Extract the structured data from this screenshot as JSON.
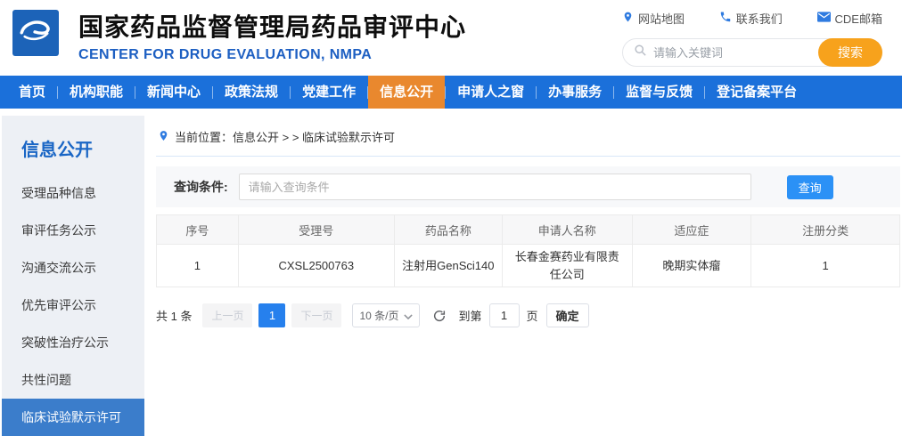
{
  "header": {
    "title": "国家药品监督管理局药品审评中心",
    "subtitle": "CENTER FOR DRUG EVALUATION, NMPA",
    "links": [
      {
        "label": "网站地图",
        "icon": "location-pin-icon"
      },
      {
        "label": "联系我们",
        "icon": "phone-icon"
      },
      {
        "label": "CDE邮箱",
        "icon": "mail-icon"
      }
    ],
    "search": {
      "placeholder": "请输入关键词",
      "button_label": "搜索"
    }
  },
  "nav": {
    "items": [
      {
        "label": "首页",
        "active": false
      },
      {
        "label": "机构职能",
        "active": false
      },
      {
        "label": "新闻中心",
        "active": false
      },
      {
        "label": "政策法规",
        "active": false
      },
      {
        "label": "党建工作",
        "active": false
      },
      {
        "label": "信息公开",
        "active": true
      },
      {
        "label": "申请人之窗",
        "active": false
      },
      {
        "label": "办事服务",
        "active": false
      },
      {
        "label": "监督与反馈",
        "active": false
      },
      {
        "label": "登记备案平台",
        "active": false
      }
    ]
  },
  "sidebar": {
    "title": "信息公开",
    "items": [
      {
        "label": "受理品种信息",
        "selected": false
      },
      {
        "label": "审评任务公示",
        "selected": false
      },
      {
        "label": "沟通交流公示",
        "selected": false
      },
      {
        "label": "优先审评公示",
        "selected": false
      },
      {
        "label": "突破性治疗公示",
        "selected": false
      },
      {
        "label": "共性问题",
        "selected": false
      },
      {
        "label": "临床试验默示许可",
        "selected": true
      }
    ]
  },
  "breadcrumb": {
    "text": "当前位置：信息公开 > > 临床试验默示许可"
  },
  "query": {
    "label": "查询条件:",
    "placeholder": "请输入查询条件",
    "button_label": "查询"
  },
  "table": {
    "headers": [
      "序号",
      "受理号",
      "药品名称",
      "申请人名称",
      "适应症",
      "注册分类"
    ],
    "rows": [
      [
        "1",
        "CXSL2500763",
        "注射用GenSci140",
        "长春金赛药业有限责任公司",
        "晚期实体瘤",
        "1"
      ]
    ]
  },
  "pagination": {
    "total_text": "共 1 条",
    "prev_label": "上一页",
    "current_page": "1",
    "next_label": "下一页",
    "page_size_label": "10 条/页",
    "goto_label": "到第",
    "goto_value": "1",
    "page_suffix": "页",
    "confirm_label": "确定"
  },
  "colors": {
    "nav_blue": "#1b70da",
    "active_tab_orange": "#e9882e",
    "search_button_orange": "#f7a21c",
    "subtitle_blue": "#1d5fc2",
    "logo_blue": "#1c63b8",
    "sidebar_bg": "#edf0f5",
    "sidebar_selected_blue": "#3b7dcb",
    "query_button_blue": "#2b91f6",
    "current_page_blue": "#2680ed",
    "icon_blue": "#2f7be0"
  }
}
